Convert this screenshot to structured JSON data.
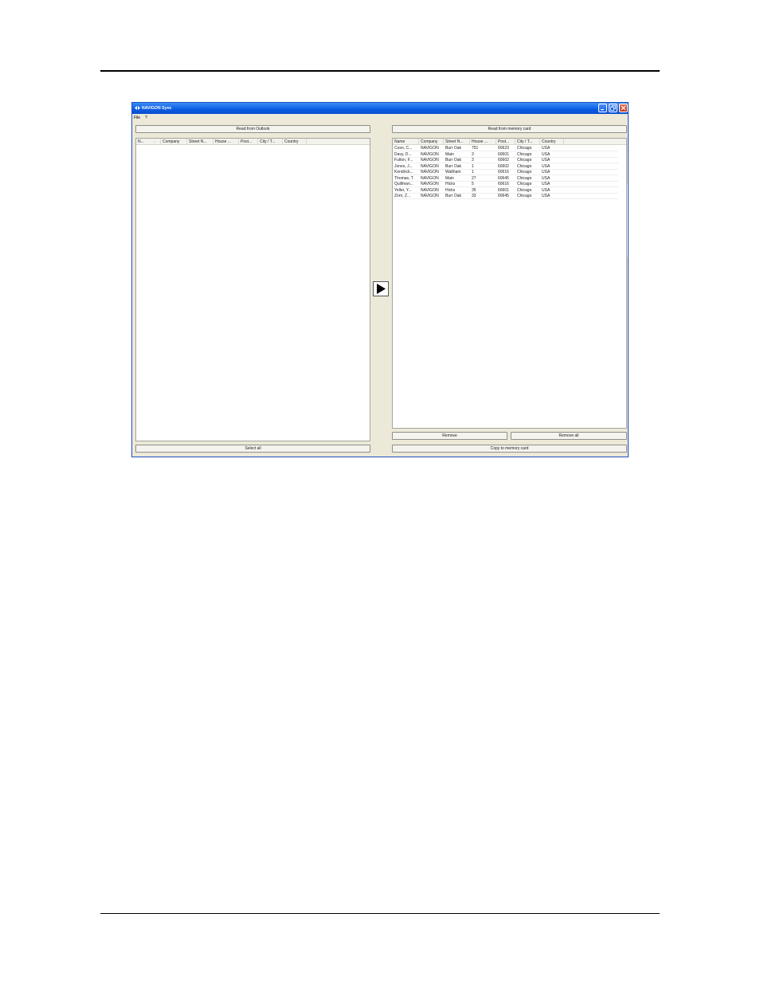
{
  "window": {
    "title": "NAVIGON Sync"
  },
  "menu": {
    "items": [
      "File",
      "?"
    ]
  },
  "left_panel": {
    "read_button": "Read from Outlook",
    "columns": [
      "N...",
      "Company",
      "Street N...",
      "House ...",
      "Post...",
      "City / T...",
      "Country"
    ],
    "sort_indicator": "^",
    "rows": [],
    "select_all_button": "Select all"
  },
  "right_panel": {
    "read_button": "Read from memory card",
    "columns": [
      "Name",
      "Company",
      "Street N...",
      "House ...",
      "Post...",
      "City / T...",
      "Country"
    ],
    "rows": [
      [
        "Cosn, C...",
        "NAVIGON",
        "Burr Oak",
        "751",
        "60623",
        "Chicago",
        "USA"
      ],
      [
        "Davy, D...",
        "NAVIGON",
        "Main",
        "3",
        "60601",
        "Chicago",
        "USA"
      ],
      [
        "Fulton, F...",
        "NAVIGON",
        "Burr Oak",
        "3",
        "60602",
        "Chicago",
        "USA"
      ],
      [
        "Jones, J...",
        "NAVIGON",
        "Burr Oak",
        "1",
        "60602",
        "Chicago",
        "USA"
      ],
      [
        "Kendrick...",
        "NAVIGON",
        "Waltham",
        "1",
        "60616",
        "Chicago",
        "USA"
      ],
      [
        "Thomas, T",
        "NAVIGON",
        "Main",
        "27",
        "60645",
        "Chicago",
        "USA"
      ],
      [
        "Quillman...",
        "NAVIGON",
        "Hicks",
        "5",
        "60616",
        "Chicago",
        "USA"
      ],
      [
        "Yeller, Y...",
        "NAVIGON",
        "Hicks",
        "35",
        "60601",
        "Chicago",
        "USA"
      ],
      [
        "Zorn, Z...",
        "NAVIGON",
        "Burr Oak",
        "33",
        "60645",
        "Chicago",
        "USA"
      ]
    ],
    "remove_button": "Remove",
    "remove_all_button": "Remove all",
    "copy_button": "Copy to memory card"
  },
  "transfer_button_icon": "play-arrow-icon",
  "colors": {
    "titlebar": "#0a5be0",
    "window_bg": "#ece9d8",
    "close_button": "#c73614"
  }
}
